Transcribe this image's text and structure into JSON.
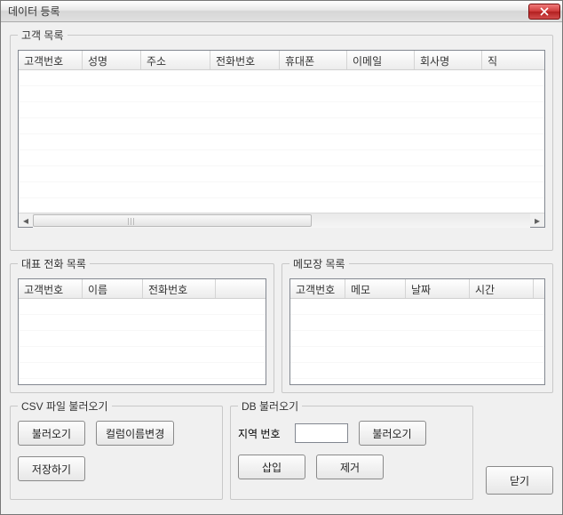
{
  "window": {
    "title": "데이터 등록"
  },
  "groups": {
    "customers": "고객 목록",
    "phones": "대표 전화 목록",
    "memos": "메모장 목록",
    "csv": "CSV 파일 불러오기",
    "db": "DB 불러오기"
  },
  "columns": {
    "customers": [
      "고객번호",
      "성명",
      "주소",
      "전화번호",
      "휴대폰",
      "이메일",
      "회사명",
      "직"
    ],
    "phones": [
      "고객번호",
      "이름",
      "전화번호",
      ""
    ],
    "memos": [
      "고객번호",
      "메모",
      "날짜",
      "시간",
      ""
    ]
  },
  "buttons": {
    "csv_load": "불러오기",
    "csv_rename_cols": "컬럼이름변경",
    "csv_save": "저장하기",
    "db_load": "불러오기",
    "db_insert": "삽입",
    "db_delete": "제거",
    "close": "닫기"
  },
  "labels": {
    "area_code": "지역 번호"
  },
  "inputs": {
    "area_code": ""
  }
}
